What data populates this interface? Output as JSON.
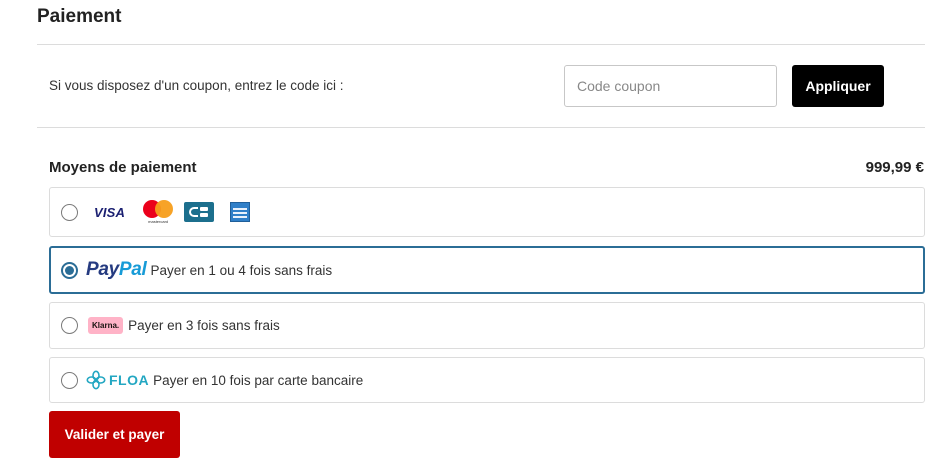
{
  "title": "Paiement",
  "coupon": {
    "prompt": "Si vous disposez d'un coupon, entrez le code ici :",
    "placeholder": "Code coupon",
    "apply_label": "Appliquer"
  },
  "payment": {
    "section_title": "Moyens de paiement",
    "amount": "999,99 €",
    "options": [
      {
        "id": "card",
        "selected": false,
        "icons": [
          "visa-icon",
          "mastercard-icon",
          "cb-icon",
          "amex-icon"
        ],
        "visa_text": "VISA",
        "mastercard_text": "mastercard"
      },
      {
        "id": "paypal",
        "selected": true,
        "brand_pay": "Pay",
        "brand_pal": "Pal",
        "label": "Payer en 1 ou 4 fois sans frais"
      },
      {
        "id": "klarna",
        "selected": false,
        "brand": "Klarna.",
        "label": "Payer en 3 fois sans frais"
      },
      {
        "id": "floa",
        "selected": false,
        "brand": "FLOA",
        "label": "Payer en 10 fois par carte bancaire"
      }
    ]
  },
  "submit_label": "Valider et payer",
  "colors": {
    "accent": "#2b6d96",
    "submit": "#c00000",
    "apply": "#000000",
    "paypal_dark": "#253b80",
    "paypal_light": "#179bd7",
    "klarna": "#ffb3c7",
    "floa": "#23a7c2"
  }
}
